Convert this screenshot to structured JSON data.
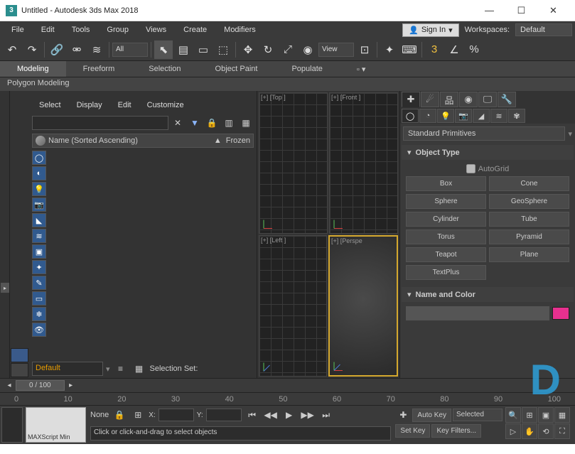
{
  "title": "Untitled - Autodesk 3ds Max 2018",
  "menus": [
    "File",
    "Edit",
    "Tools",
    "Group",
    "Views",
    "Create",
    "Modifiers"
  ],
  "signin": "Sign In",
  "workspaces_label": "Workspaces:",
  "workspace": "Default",
  "toolbar": {
    "all": "All",
    "view": "View"
  },
  "ribbon": {
    "tabs": [
      "Modeling",
      "Freeform",
      "Selection",
      "Object Paint",
      "Populate"
    ],
    "sub": "Polygon Modeling"
  },
  "scene": {
    "menus": [
      "Select",
      "Display",
      "Edit",
      "Customize"
    ],
    "header": "Name (Sorted Ascending)",
    "frozen": "Frozen",
    "layer": "Default",
    "selset": "Selection Set:"
  },
  "viewports": {
    "tl": "[+] [Top ]",
    "tr": "[+] [Front ]",
    "bl": "[+] [Left ]",
    "br": "[+] [Perspe"
  },
  "cmd": {
    "dropdown": "Standard Primitives",
    "objtype": "Object Type",
    "autogrid": "AutoGrid",
    "buttons": [
      "Box",
      "Cone",
      "Sphere",
      "GeoSphere",
      "Cylinder",
      "Tube",
      "Torus",
      "Pyramid",
      "Teapot",
      "Plane",
      "TextPlus",
      ""
    ],
    "namecolor": "Name and Color"
  },
  "timeline": {
    "frame": "0 / 100",
    "ticks": [
      "0",
      "10",
      "20",
      "30",
      "40",
      "50",
      "60",
      "70",
      "80",
      "90",
      "100"
    ]
  },
  "status": {
    "none": "None",
    "x": "X:",
    "y": "Y:",
    "script": "MAXScript Min",
    "prompt": "Click or click-and-drag to select objects",
    "autokey": "Auto Key",
    "setkey": "Set Key",
    "selected": "Selected",
    "keyfilters": "Key Filters..."
  }
}
